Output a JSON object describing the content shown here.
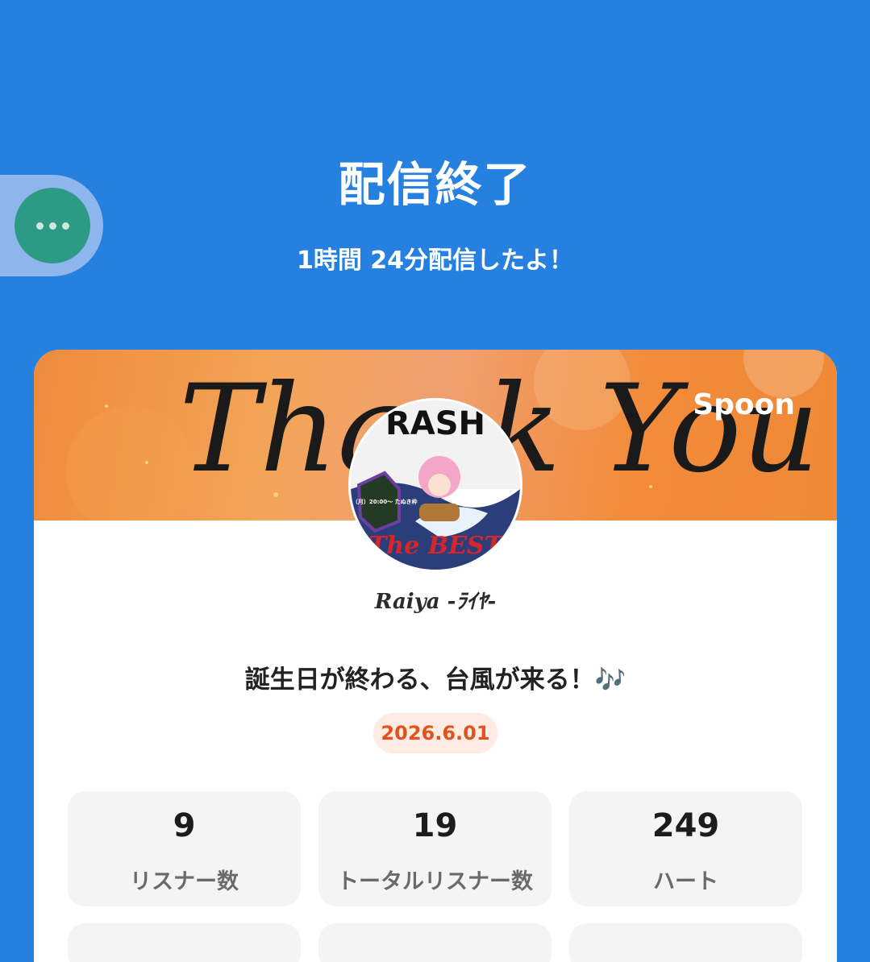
{
  "header": {
    "title": "配信終了",
    "subtitle": "1時間 24分配信したよ！"
  },
  "menu_button": {
    "icon": "more-horizontal-icon"
  },
  "card": {
    "banner_text": "Thank You",
    "brand": "Spoon",
    "avatar": {
      "top_text": "RASH",
      "bottom_text": "The BEST",
      "event_text": "6/1（月）20:00〜 たぬき枠"
    },
    "username": "Raiya -ﾗｲﾔ-",
    "caption": "誕生日が終わる、台風が来る！",
    "caption_emoji": "🎶",
    "date": "2026.6.01",
    "stats": [
      {
        "value": "9",
        "label": "リスナー数"
      },
      {
        "value": "19",
        "label": "トータルリスナー数"
      },
      {
        "value": "249",
        "label": "ハート"
      }
    ]
  },
  "colors": {
    "background": "#2680e0",
    "menu_button": "#2d9a86",
    "date_text": "#e0531d",
    "date_badge": "#fdebe4"
  }
}
